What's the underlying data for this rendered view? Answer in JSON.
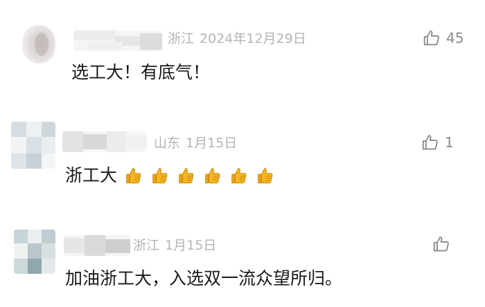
{
  "comments": [
    {
      "location": "浙江",
      "date": "2024年12月29日",
      "like_count": "45",
      "text": "选工大！有底气！",
      "emojis": []
    },
    {
      "location": "山东",
      "date": "1月15日",
      "like_count": "1",
      "text": "浙工大",
      "emojis": [
        "thumbs-up",
        "thumbs-up",
        "thumbs-up",
        "thumbs-up",
        "thumbs-up",
        "thumbs-up"
      ]
    },
    {
      "location": "浙江",
      "date": "1月15日",
      "like_count": "",
      "text": "加油浙工大，入选双一流众望所归。",
      "emojis": []
    }
  ],
  "colors": {
    "text": "#1a1a1a",
    "meta": "#b4b4b4",
    "like_icon": "#8a8a8a",
    "emoji": "#f7b521"
  },
  "icons": {
    "like": "thumbs-up-outline-icon",
    "emoji": "thumbs-up-emoji-icon"
  }
}
